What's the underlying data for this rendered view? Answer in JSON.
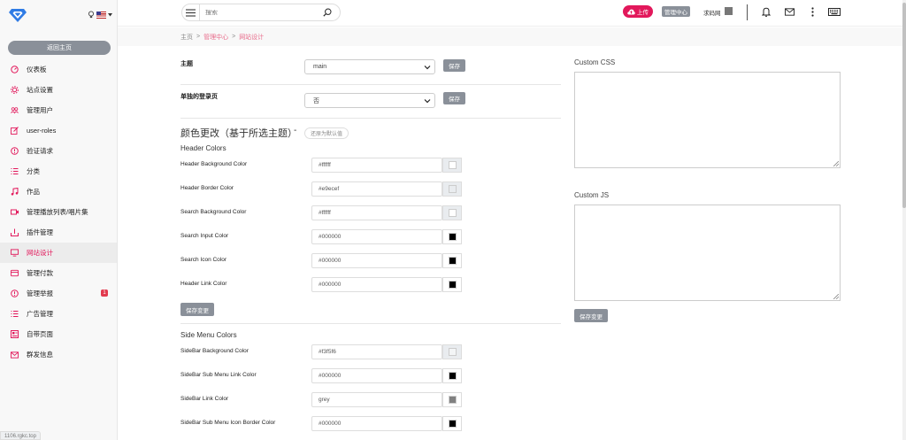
{
  "sidebar": {
    "back_button": "返回主页",
    "items": [
      {
        "label": "仪表板",
        "icon": "dashboard-icon"
      },
      {
        "label": "站点设置",
        "icon": "settings-icon"
      },
      {
        "label": "管理用户",
        "icon": "users-icon"
      },
      {
        "label": "user-roles",
        "icon": "edit-icon"
      },
      {
        "label": "验证请求",
        "icon": "alert-icon"
      },
      {
        "label": "分类",
        "icon": "list-icon"
      },
      {
        "label": "作品",
        "icon": "music-icon"
      },
      {
        "label": "管理播放列表/唱片集",
        "icon": "playlist-icon"
      },
      {
        "label": "插件管理",
        "icon": "download-icon"
      },
      {
        "label": "网站设计",
        "icon": "monitor-icon"
      },
      {
        "label": "管理付款",
        "icon": "card-icon"
      },
      {
        "label": "管理举报",
        "icon": "alert-icon",
        "badge": "1"
      },
      {
        "label": "广告管理",
        "icon": "list-icon"
      },
      {
        "label": "自带页面",
        "icon": "page-icon"
      },
      {
        "label": "群发信息",
        "icon": "mail-icon"
      }
    ],
    "active_index": 9,
    "status_url": "1106.rgkc.top"
  },
  "header": {
    "search_placeholder": "搜索",
    "upload_label": "上传",
    "admin_label": "管理中心",
    "user_name": "求码网"
  },
  "breadcrumb": {
    "home": "主页",
    "sep": ">",
    "admin": "管理中心",
    "current": "网站设计"
  },
  "form": {
    "theme_label": "主题",
    "theme_value": "main",
    "login_label": "单独的登录页",
    "login_value": "否",
    "save_label": "保存",
    "color_title": "颜色更改（基于所选主题）",
    "color_dash": "-",
    "reset_label": "还原为默认值",
    "header_colors_title": "Header Colors",
    "header_colors": [
      {
        "label": "Header Background Color",
        "value": "#ffffff",
        "color": "#ffffff"
      },
      {
        "label": "Header Border Color",
        "value": "#e9ecef",
        "color": "#e9ecef"
      },
      {
        "label": "Search Background Color",
        "value": "#ffffff",
        "color": "#ffffff"
      },
      {
        "label": "Search Input Color",
        "value": "#000000",
        "color": "#000000"
      },
      {
        "label": "Search Icon Color",
        "value": "#000000",
        "color": "#000000"
      },
      {
        "label": "Header Link Color",
        "value": "#000000",
        "color": "#000000"
      }
    ],
    "save_changes_label": "保存变更",
    "side_menu_title": "Side Menu Colors",
    "side_colors": [
      {
        "label": "SideBar Background Color",
        "value": "#f3f5f6",
        "color": "#f3f5f6"
      },
      {
        "label": "SideBar Sub Menu Link Color",
        "value": "#000000",
        "color": "#000000"
      },
      {
        "label": "SideBar Link Color",
        "value": "grey",
        "color": "#808080"
      },
      {
        "label": "SideBar Sub Menu Icon Border Color",
        "value": "#000000",
        "color": "#000000"
      }
    ]
  },
  "custom": {
    "css_label": "Custom CSS",
    "js_label": "Custom JS",
    "save_changes_label": "保存变更"
  },
  "colors": {
    "accent": "#e2185b",
    "button_gray": "#8a9099"
  }
}
